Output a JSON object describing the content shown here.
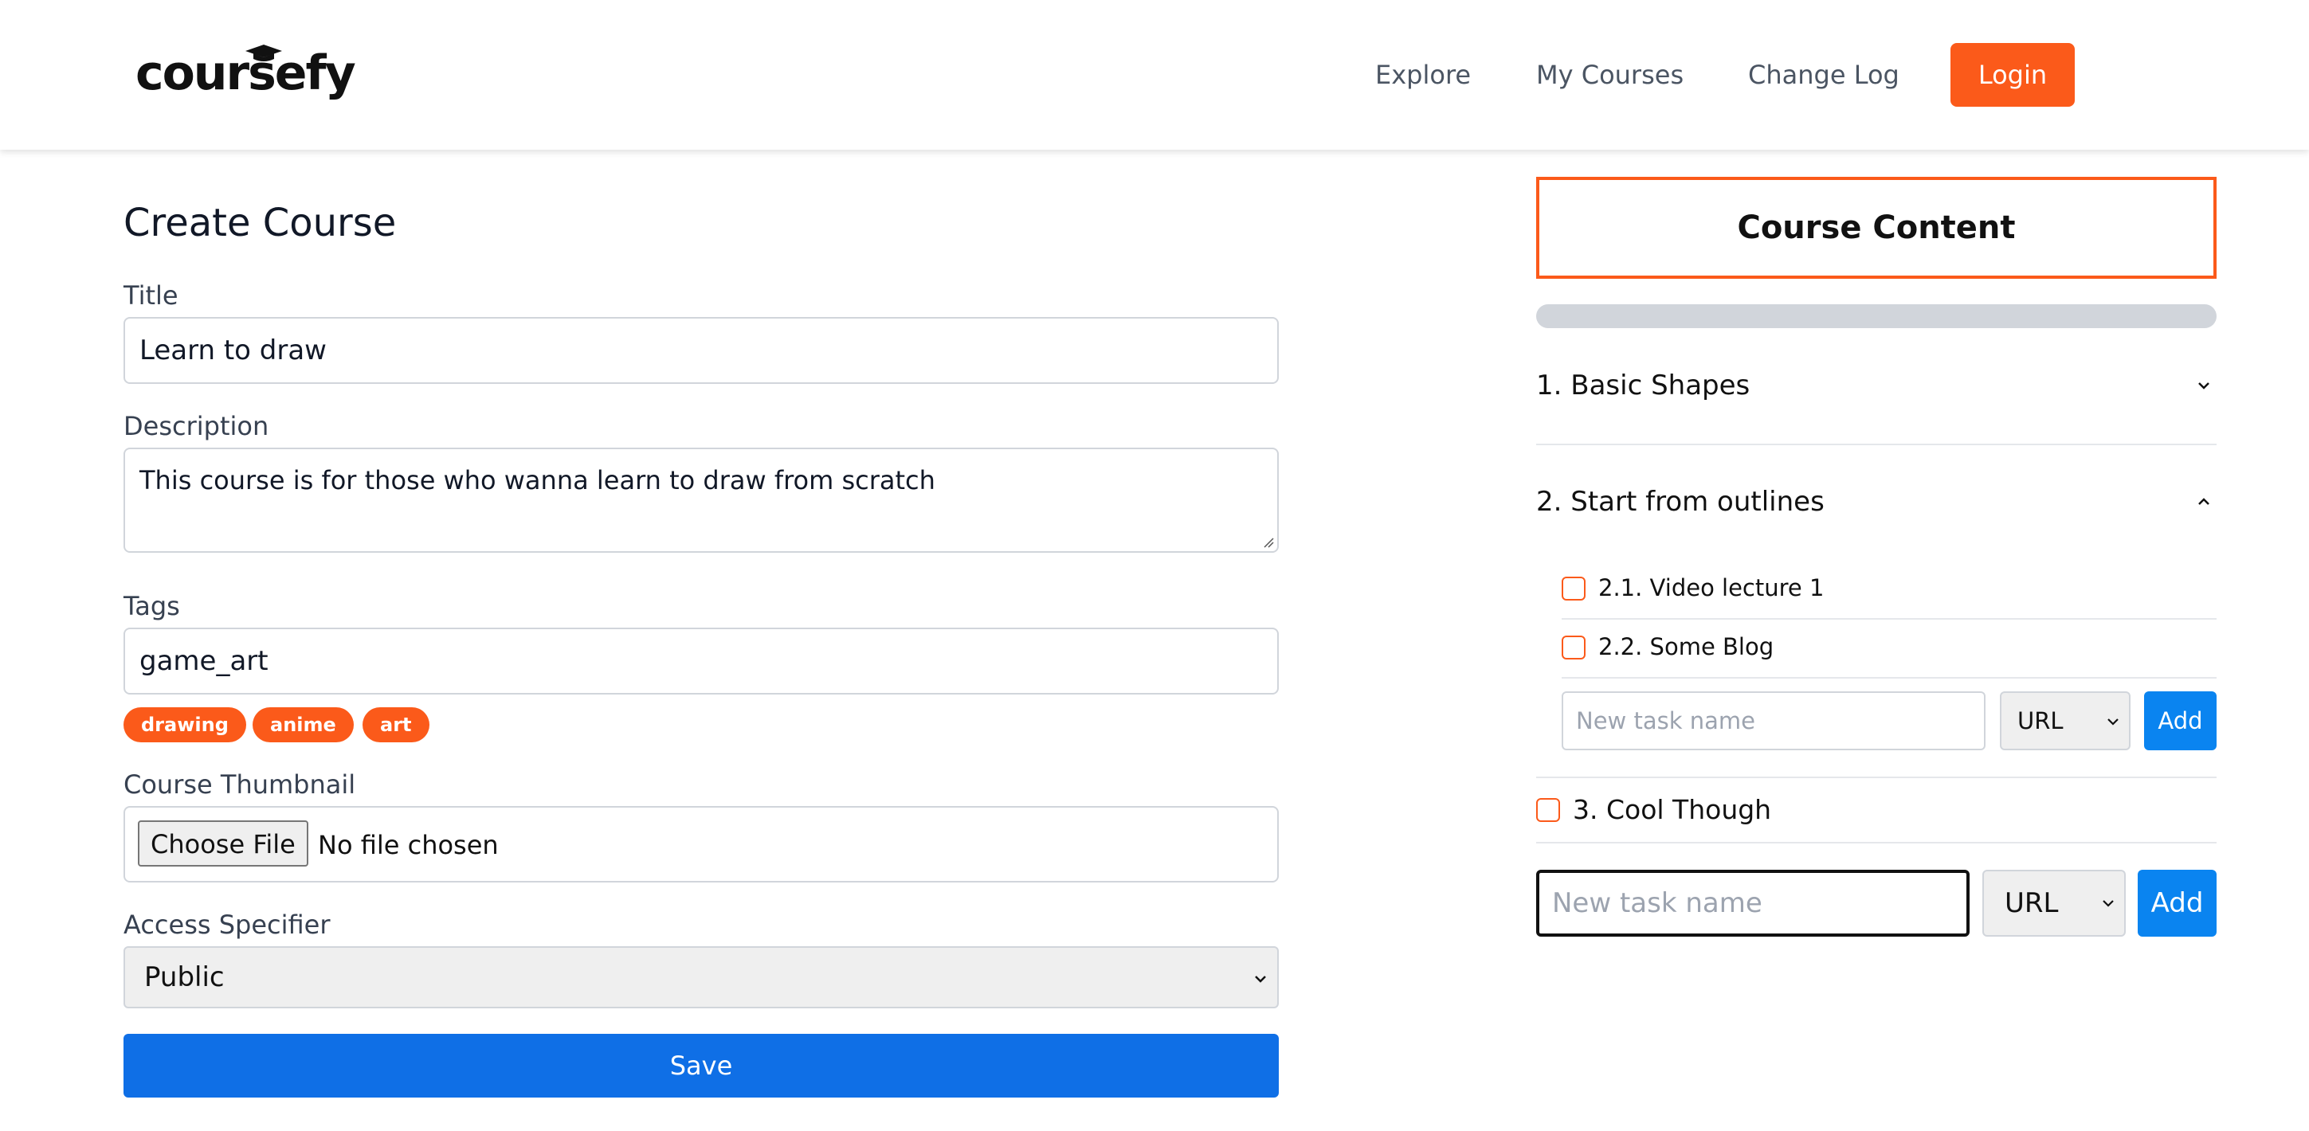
{
  "brand": {
    "name": "coursefy"
  },
  "nav": {
    "explore": "Explore",
    "my_courses": "My Courses",
    "change_log": "Change Log",
    "login": "Login"
  },
  "form": {
    "page_title": "Create Course",
    "title_label": "Title",
    "title_value": "Learn to draw",
    "description_label": "Description",
    "description_value": "This course is for those who wanna learn to draw from scratch",
    "tags_label": "Tags",
    "tags_input_value": "game_art",
    "tags": [
      "drawing",
      "anime",
      "art"
    ],
    "thumbnail_label": "Course Thumbnail",
    "choose_file": "Choose File",
    "file_status": "No file chosen",
    "access_label": "Access Specifier",
    "access_value": "Public",
    "save": "Save"
  },
  "content": {
    "heading": "Course Content",
    "progress_fraction": 0,
    "sections": [
      {
        "title": "1. Basic Shapes",
        "expanded": false
      },
      {
        "title": "2. Start from outlines",
        "expanded": true,
        "tasks": [
          "2.1. Video lecture 1",
          "2.2. Some Blog"
        ],
        "new_task_placeholder": "New task name",
        "type_value": "URL",
        "add": "Add"
      },
      {
        "title": "3. Cool Though",
        "checkbox": true
      }
    ],
    "new_task": {
      "placeholder": "New task name",
      "type_value": "URL",
      "add": "Add"
    }
  },
  "colors": {
    "accent": "#fb5a1a",
    "primary_blue": "#0f6fe6",
    "add_blue": "#0a84f0",
    "progress_track": "#d1d5db"
  },
  "icons": {
    "logo_cap": "graduation-cap-icon",
    "collapsed": "chevron-down-icon",
    "expanded": "chevron-up-icon",
    "select": "chevron-down-icon"
  }
}
